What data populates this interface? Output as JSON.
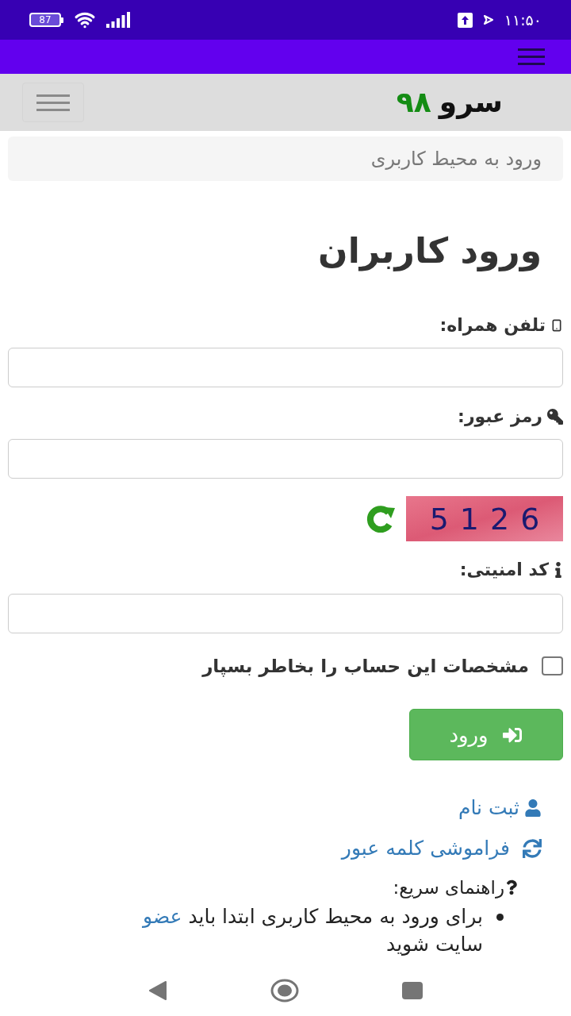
{
  "status_bar": {
    "battery": "87",
    "time": "۱۱:۵۰"
  },
  "navbar": {
    "brand": [
      {
        "text": "سرو",
        "color": "#111111"
      },
      {
        "text": "۹۸",
        "color": "#148c14"
      }
    ]
  },
  "breadcrumb": {
    "text": "ورود به محیط کاربری"
  },
  "heading": "ورود کاربران",
  "form": {
    "phone": {
      "label": "تلفن همراه:"
    },
    "password": {
      "label": "رمز عبور:"
    },
    "captcha": {
      "code": "5126"
    },
    "security_code": {
      "label": "کد امنیتی:"
    },
    "remember": {
      "label": "مشخصات این حساب را بخاطر بسپار",
      "checked": false
    },
    "submit": {
      "label": "ورود"
    }
  },
  "links": [
    {
      "kind": "register",
      "label": "ثبت نام"
    },
    {
      "kind": "forgot_password",
      "label": "فراموشی کلمه عبور"
    }
  ],
  "help": {
    "title": "راهنمای سریع:",
    "items": [
      {
        "before": "برای ورود به محیط کاربری ابتدا باید",
        "link": "عضو",
        "after": "سایت شوید"
      }
    ]
  }
}
